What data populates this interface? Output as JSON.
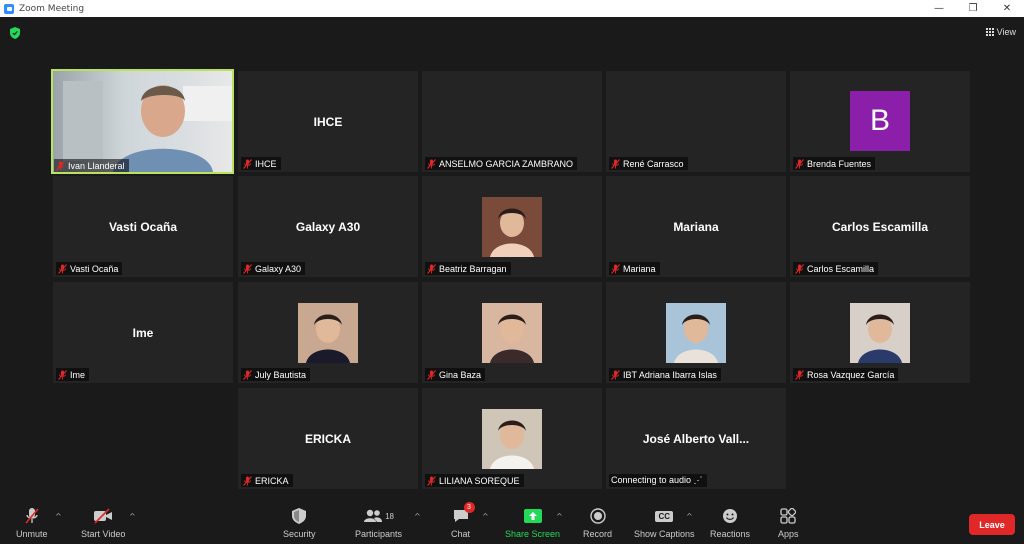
{
  "window": {
    "title": "Zoom Meeting",
    "minimize": "—",
    "restore": "❐",
    "close": "✕"
  },
  "view_label": "View",
  "colors": {
    "active_border": "#b9e35f",
    "leave": "#e02828",
    "share": "#23d959",
    "avatar_b": "#8b1fa9"
  },
  "tiles": [
    {
      "name": "Ivan Llanderal",
      "type": "video",
      "active": true
    },
    {
      "name": "IHCE",
      "display": "IHCE",
      "type": "text"
    },
    {
      "name": "ANSELMO GARCIA ZAMBRANO",
      "display": "",
      "type": "blank"
    },
    {
      "name": "René Carrasco",
      "display": "",
      "type": "blank"
    },
    {
      "name": "Brenda Fuentes",
      "avatar": "B",
      "type": "avatar"
    },
    {
      "name": "Vasti Ocaña",
      "display": "Vasti Ocaña",
      "type": "text"
    },
    {
      "name": "Galaxy A30",
      "display": "Galaxy A30",
      "type": "text"
    },
    {
      "name": "Beatriz Barragan",
      "type": "photo"
    },
    {
      "name": "Mariana",
      "display": "Mariana",
      "type": "text"
    },
    {
      "name": "Carlos Escamilla",
      "display": "Carlos Escamilla",
      "type": "text"
    },
    {
      "name": "Ime",
      "display": "Ime",
      "type": "text"
    },
    {
      "name": "July Bautista",
      "type": "photo"
    },
    {
      "name": "Gina Baza",
      "type": "photo"
    },
    {
      "name": "IBT Adriana Ibarra Islas",
      "type": "photo"
    },
    {
      "name": "Rosa Vazquez García",
      "type": "photo"
    },
    {
      "name": "ERICKA",
      "display": "ERICKA",
      "type": "text"
    },
    {
      "name": "LILIANA SOREQUE",
      "type": "photo"
    },
    {
      "name": "Connecting to audio ⋰",
      "display": "José Alberto Vall...",
      "type": "text",
      "no_mic": true
    }
  ],
  "toolbar": {
    "unmute": "Unmute",
    "start_video": "Start Video",
    "security": "Security",
    "participants": "Participants",
    "participants_count": "18",
    "chat": "Chat",
    "chat_badge": "3",
    "share_screen": "Share Screen",
    "record": "Record",
    "show_captions": "Show Captions",
    "captions_icon": "CC",
    "reactions": "Reactions",
    "apps": "Apps",
    "leave": "Leave",
    "caret": "^"
  }
}
